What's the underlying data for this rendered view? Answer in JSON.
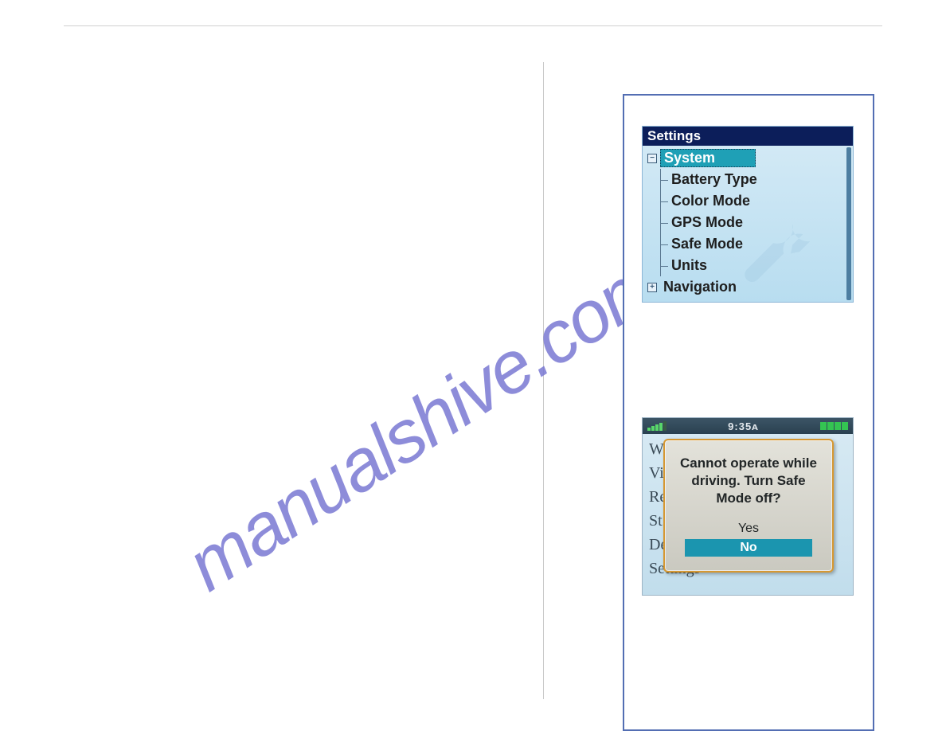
{
  "watermark": "manualshive.com",
  "settings_panel": {
    "title": "Settings",
    "root_expanded": {
      "label": "System",
      "expander": "−"
    },
    "children": [
      "Battery Type",
      "Color Mode",
      "GPS Mode",
      "Safe Mode",
      "Units"
    ],
    "root_collapsed": {
      "label": "Navigation",
      "expander": "+"
    }
  },
  "dialog_panel": {
    "clock": "9:35ᴀ",
    "bg_items": [
      "W",
      "Vi",
      "Re",
      "St",
      "De",
      "Settings"
    ],
    "message": "Cannot operate while driving. Turn Safe Mode off?",
    "option_yes": "Yes",
    "option_no": "No"
  }
}
